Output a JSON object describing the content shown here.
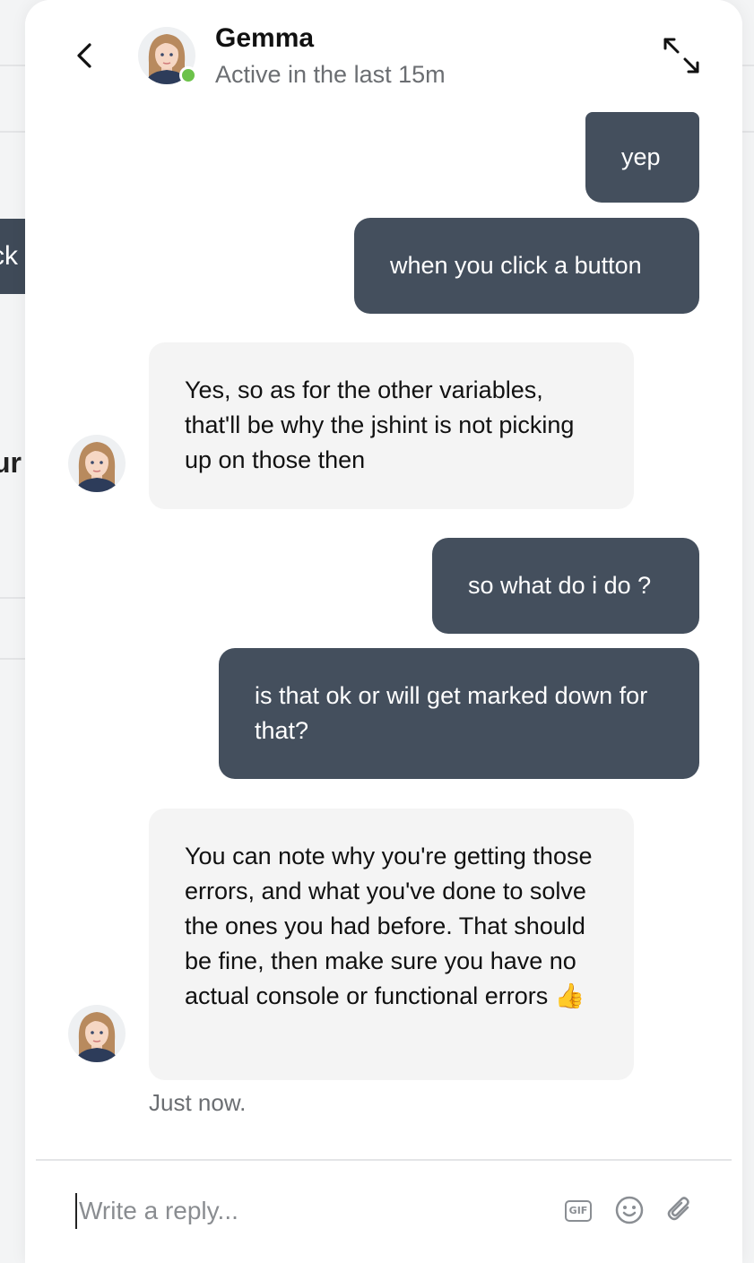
{
  "header": {
    "contact_name": "Gemma",
    "contact_status": "Active in the last 15m",
    "status_color": "#6cc24a"
  },
  "background": {
    "chip_text": "ck",
    "fragment_text": "ur"
  },
  "messages": [
    {
      "direction": "outgoing",
      "text": "yep"
    },
    {
      "direction": "outgoing",
      "text": "when you click a button"
    },
    {
      "direction": "incoming",
      "text": "Yes, so as for the other variables, that'll be why the jshint is not picking up on those then"
    },
    {
      "direction": "outgoing",
      "text": "so what do i do ?"
    },
    {
      "direction": "outgoing",
      "text": "is that ok or will get marked down for that?"
    },
    {
      "direction": "incoming",
      "text": "You can note why you're getting those errors, and what you've done to solve the ones you had before. That should be fine, then make sure you have no actual console or functional errors 👍"
    }
  ],
  "timestamp": "Just now.",
  "composer": {
    "placeholder": "Write a reply...",
    "value": "",
    "gif_label": "GIF",
    "icons": [
      "gif-icon",
      "emoji-icon",
      "paperclip-icon"
    ]
  },
  "colors": {
    "outgoing_bubble": "#444f5d",
    "incoming_bubble": "#f4f4f4",
    "online_dot": "#6cc24a"
  }
}
